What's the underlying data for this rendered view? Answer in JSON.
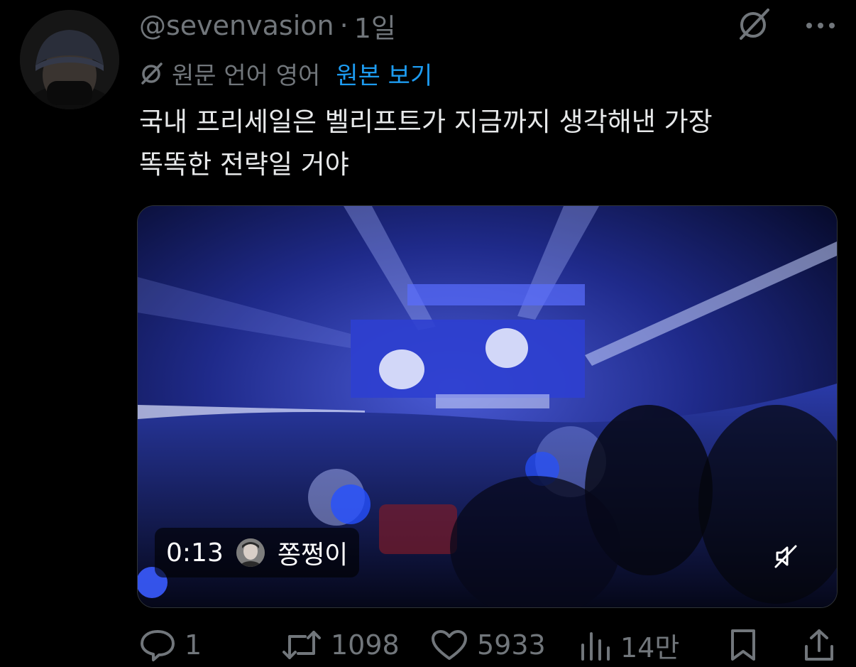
{
  "tweet": {
    "handle": "@sevenvasion",
    "separator": "·",
    "time_ago": "1일",
    "translation": {
      "label": "원문 언어 영어",
      "show_original": "원본 보기"
    },
    "text": "국내 프리세일은 벨리프트가 지금까지 생각해낸 가장\n똑똑한 전략일 거야"
  },
  "video": {
    "duration": "0:13",
    "creator": "쫑쩡이",
    "muted": true
  },
  "actions": {
    "replies": "1",
    "retweets": "1098",
    "likes": "5933",
    "views": "14만"
  },
  "colors": {
    "background": "#000000",
    "text_primary": "#e7e9ea",
    "text_secondary": "#71767b",
    "accent": "#1d9bf0"
  },
  "icons": {
    "translate": "translate-icon",
    "more": "more-icon",
    "reply": "reply-icon",
    "retweet": "retweet-icon",
    "like": "like-icon",
    "views": "views-icon",
    "bookmark": "bookmark-icon",
    "share": "share-icon",
    "mute": "mute-icon"
  }
}
